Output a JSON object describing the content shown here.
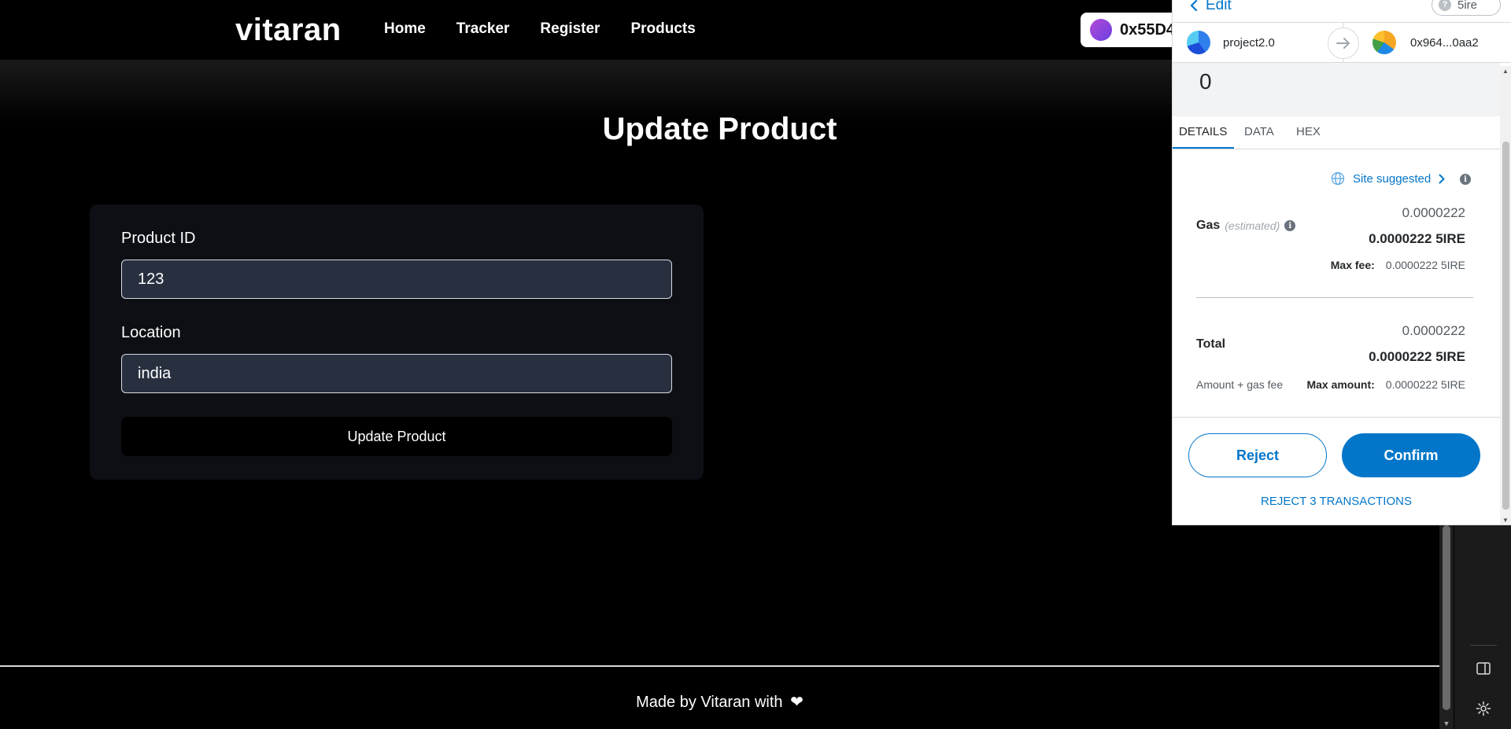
{
  "navbar": {
    "brand": "vitaran",
    "links": [
      "Home",
      "Tracker",
      "Register",
      "Products"
    ],
    "wallet_address": "0x55D4"
  },
  "main": {
    "title": "Update Product",
    "fields": [
      {
        "label": "Product ID",
        "value": "123"
      },
      {
        "label": "Location",
        "value": "india"
      }
    ],
    "submit_label": "Update Product"
  },
  "footer": {
    "text": "Made by Vitaran with",
    "heart": "❤"
  },
  "popup": {
    "edit_label": "Edit",
    "network": "5ire",
    "help_glyph": "?",
    "from_account": "project2.0",
    "to_account": "0x964...0aa2",
    "amount": "0",
    "tabs": [
      "DETAILS",
      "DATA",
      "HEX"
    ],
    "active_tab": "DETAILS",
    "site_suggested": "Site suggested",
    "info_glyph": "i",
    "gas": {
      "label": "Gas",
      "sub": "(estimated)",
      "primary": "0.0000222",
      "bold": "0.0000222 5IRE",
      "max_fee_label": "Max fee:",
      "max_fee_value": "0.0000222 5IRE"
    },
    "total": {
      "label": "Total",
      "primary": "0.0000222",
      "bold": "0.0000222 5IRE",
      "sub": "Amount + gas fee",
      "max_amount_label": "Max amount:",
      "max_amount_value": "0.0000222 5IRE"
    },
    "reject_label": "Reject",
    "confirm_label": "Confirm",
    "reject_all_label": "REJECT 3 TRANSACTIONS"
  },
  "colors": {
    "accent": "#0376c9",
    "page_bg": "#000000",
    "card_bg": "#0d0f14",
    "input_bg": "#283040"
  }
}
